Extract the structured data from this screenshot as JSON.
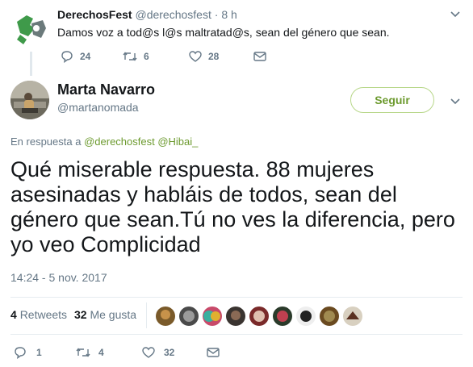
{
  "parent_tweet": {
    "author_name": "DerechosFest",
    "handle": "@derechosfest",
    "dot": "·",
    "time": "8 h",
    "text": "Damos voz a tod@s l@s maltratad@s, sean del género que sean.",
    "replies": "24",
    "retweets": "6",
    "likes": "28"
  },
  "main_tweet": {
    "author_name": "Marta Navarro",
    "handle": "@martanomada",
    "follow_label": "Seguir",
    "reply_to_prefix": "En respuesta a",
    "reply_to_users": "@derechosfest @Hibai_",
    "text": "Qué miserable respuesta. 88 mujeres asesinadas y habláis de todos, sean del género que sean.Tú no ves la diferencia, pero yo veo Complicidad",
    "timestamp": "14:24 - 5 nov. 2017",
    "retweets_count": "4",
    "retweets_label": "Retweets",
    "likes_count": "32",
    "likes_label": "Me gusta",
    "replies": "1",
    "retweets": "4",
    "likes": "32"
  },
  "colors": {
    "accent_green": "#6c9a2e",
    "muted": "#657786"
  },
  "icons": [
    "reply-icon",
    "retweet-icon",
    "like-icon",
    "dm-icon",
    "chevron-down-icon"
  ]
}
